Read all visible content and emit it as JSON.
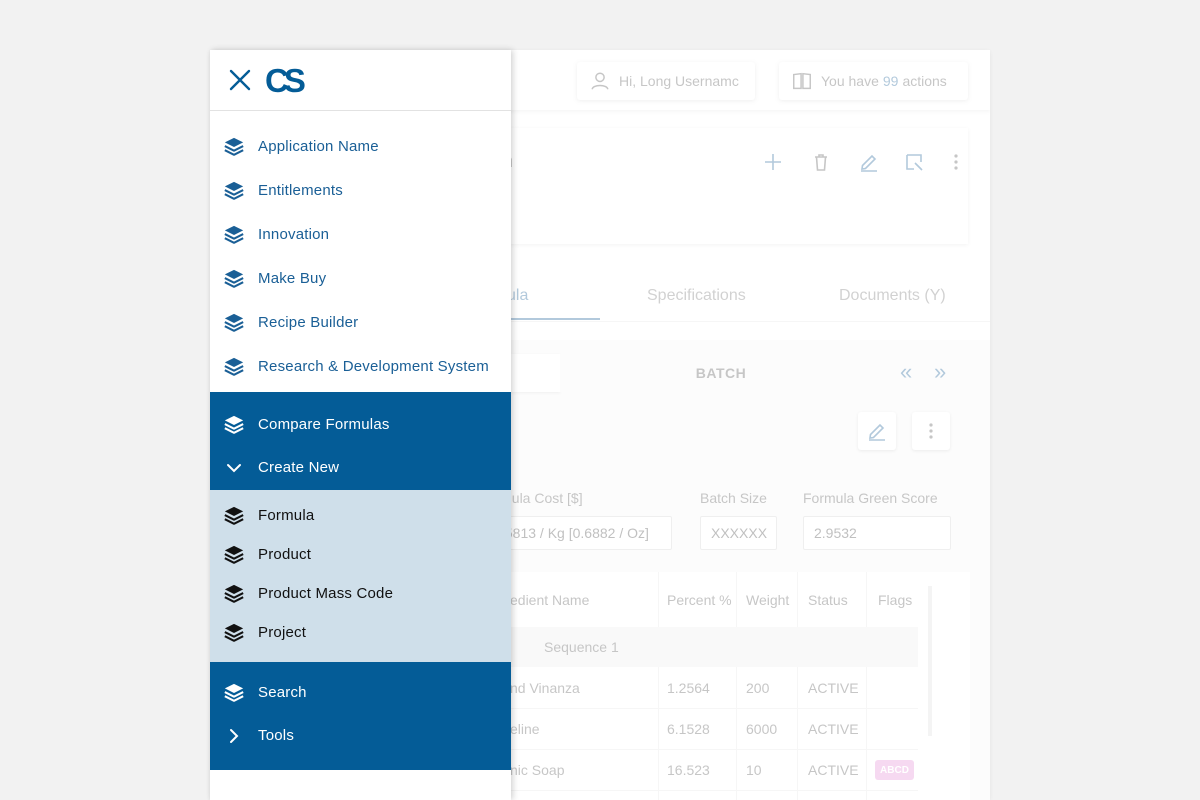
{
  "header": {
    "user_greeting": "Hi, Long Usernamc",
    "actions_prefix": "You have",
    "actions_count": "99",
    "actions_suffix": "actions"
  },
  "record": {
    "title_fragment": "nation"
  },
  "tabs": [
    {
      "label": "ula"
    },
    {
      "label": "Specifications"
    },
    {
      "label": "Documents (Y)"
    }
  ],
  "panel": {
    "batch_label": "BATCH",
    "fields": [
      {
        "label": "nula Cost [$]",
        "value": ".5813 / Kg [0.6882 / Oz]"
      },
      {
        "label": "Batch Size",
        "value": "XXXXXX"
      },
      {
        "label": "Formula Green Score",
        "value": "2.9532"
      }
    ]
  },
  "table": {
    "columns": [
      "edient Name",
      "Percent %",
      "Weight",
      "Status",
      "Flags"
    ],
    "sequence_label": "Sequence 1",
    "rows": [
      {
        "name": "nd Vinanza",
        "percent": "1.2564",
        "weight": "200",
        "status": "ACTIVE",
        "flag": ""
      },
      {
        "name": "eline",
        "percent": "6.1528",
        "weight": "6000",
        "status": "ACTIVE",
        "flag": ""
      },
      {
        "name": "nic Soap",
        "percent": "16.523",
        "weight": "10",
        "status": "ACTIVE",
        "flag": "ABCD"
      }
    ]
  },
  "drawer": {
    "logo_text": "CS",
    "applications": [
      {
        "label": "Application Name"
      },
      {
        "label": "Entitlements"
      },
      {
        "label": "Innovation"
      },
      {
        "label": "Make Buy"
      },
      {
        "label": "Recipe Builder"
      },
      {
        "label": "Research & Development System"
      }
    ],
    "compare_formulas": "Compare Formulas",
    "create_new": "Create New",
    "create_items": [
      {
        "label": "Formula"
      },
      {
        "label": "Product"
      },
      {
        "label": "Product Mass Code"
      },
      {
        "label": "Project"
      }
    ],
    "search": "Search",
    "tools": "Tools"
  },
  "colors": {
    "brand_blue": "#045c97",
    "link_blue": "#1a5f96",
    "submenu_bg": "#cfdfea",
    "flag_pink": "#e58fd6"
  },
  "icons": {
    "app_items": "layers-icon",
    "close": "close-icon",
    "expand": "chevron-down-icon",
    "collapsed": "chevron-right-icon"
  }
}
